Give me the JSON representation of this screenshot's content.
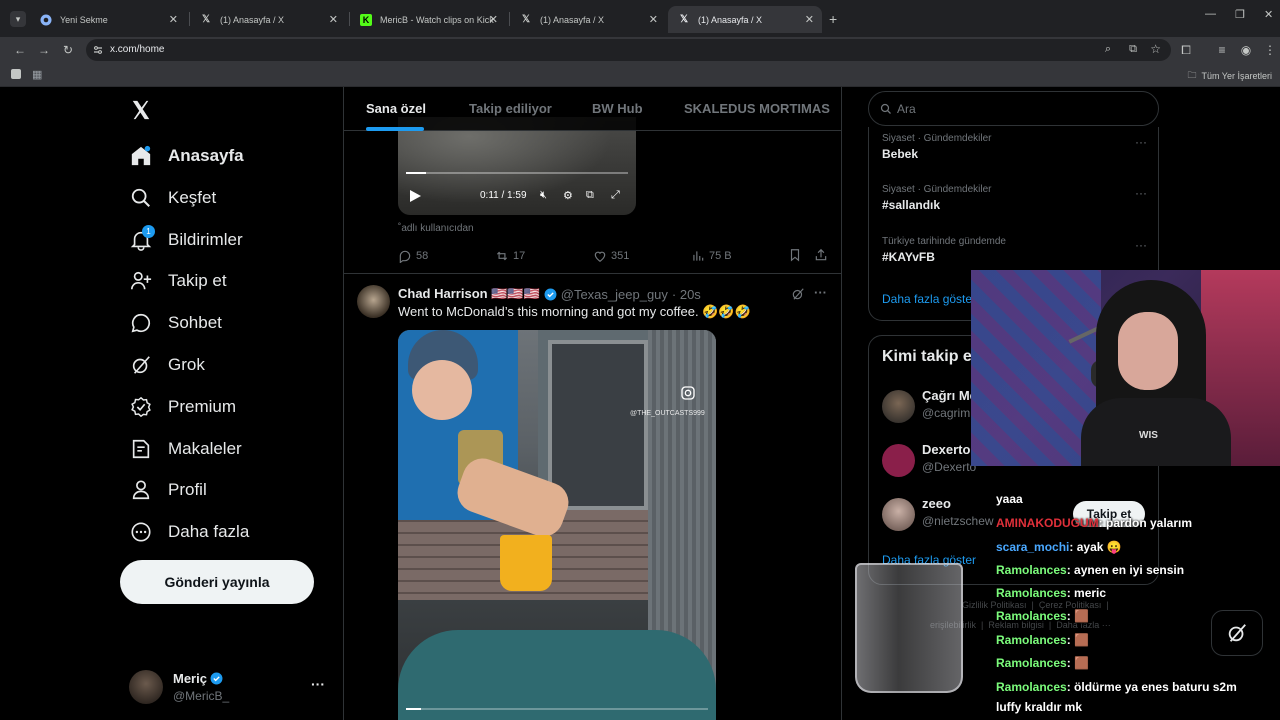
{
  "browser": {
    "tabs": [
      {
        "title": "Yeni Sekme",
        "icon": "chrome-icon"
      },
      {
        "title": "(1) Anasayfa / X",
        "icon": "x-logo-icon"
      },
      {
        "title": "MericB - Watch clips on Kick",
        "icon": "kick-icon"
      },
      {
        "title": "(1) Anasayfa / X",
        "icon": "x-logo-icon"
      },
      {
        "title": "(1) Anasayfa / X",
        "icon": "x-logo-icon",
        "active": true
      }
    ],
    "url": "x.com/home",
    "bookmarks_all": "Tüm Yer İşaretleri"
  },
  "sidebar": {
    "items": [
      {
        "label": "Anasayfa",
        "icon": "home-icon"
      },
      {
        "label": "Keşfet",
        "icon": "search-icon"
      },
      {
        "label": "Bildirimler",
        "icon": "bell-icon",
        "badge": "1"
      },
      {
        "label": "Takip et",
        "icon": "person-add-icon"
      },
      {
        "label": "Sohbet",
        "icon": "chat-icon"
      },
      {
        "label": "Grok",
        "icon": "grok-icon"
      },
      {
        "label": "Premium",
        "icon": "verified-icon"
      },
      {
        "label": "Makaleler",
        "icon": "article-icon"
      },
      {
        "label": "Profil",
        "icon": "person-icon"
      },
      {
        "label": "Daha fazla",
        "icon": "more-circle-icon"
      }
    ],
    "post_button": "Gönderi yayınla",
    "account": {
      "name": "Meriç",
      "handle": "@MericB_"
    }
  },
  "feed": {
    "tabs": [
      "Sana özel",
      "Takip ediliyor",
      "BW Hub",
      "SKALEDUS MORTIMAS"
    ],
    "video1": {
      "time": "0:11 / 1:59",
      "caption": "˚adlı kullanıcıdan",
      "progress": 0.09
    },
    "stats": {
      "replies": "58",
      "reposts": "17",
      "likes": "351",
      "views": "75 B"
    },
    "post2": {
      "author": "Chad Harrison 🇺🇸🇺🇸🇺🇸",
      "handle": "@Texas_jeep_guy",
      "time": "· 20s",
      "text": "Went to McDonald’s this morning and got my coffee. 🤣🤣🤣",
      "watermark": "@THE_OUTCASTS999",
      "progress": 0.05
    }
  },
  "right": {
    "search_placeholder": "Ara",
    "trends": [
      {
        "meta": "Siyaset · Gündemdekiler",
        "name": "Bebek"
      },
      {
        "meta": "Siyaset · Gündemdekiler",
        "name": "#sallandık"
      },
      {
        "meta": "Türkiye tarihinde gündemde",
        "name": "#KAYvFB"
      }
    ],
    "show_more": "Daha fazla göster",
    "who_to_follow_title": "Kimi takip e",
    "follow": [
      {
        "name": "Çağrı Meri",
        "handle": "@cagrim"
      },
      {
        "name": "Dexerto",
        "handle": "@Dexerto"
      },
      {
        "name": "zeeo",
        "handle": "@nietzschew"
      }
    ],
    "follow_button": "Takip et",
    "show_more2": "Daha fazla göster",
    "footer": [
      "Gizlilik Politikası",
      "Çerez Politikası",
      "erişilebilirlik",
      "Reklam bilgisi",
      "Daha fazla ···"
    ]
  },
  "chat": {
    "lines": [
      {
        "user": "",
        "text": "yaaa"
      },
      {
        "user": "AMINAKODUGUM",
        "text": ": pardon yalarım",
        "color": "#e0303a"
      },
      {
        "user": "scara_mochi",
        "text": ": ayak 😛",
        "color": "#4aa8ff"
      },
      {
        "user": "Ramolances",
        "text": ": aynen en iyi sensin",
        "color": "#7cfc7c"
      },
      {
        "user": "Ramolances",
        "text": ": meric",
        "color": "#7cfc7c"
      },
      {
        "user": "Ramolances",
        "text": ": 🟫",
        "color": "#7cfc7c"
      },
      {
        "user": "Ramolances",
        "text": ": 🟫",
        "color": "#7cfc7c"
      },
      {
        "user": "Ramolances",
        "text": ": 🟫",
        "color": "#7cfc7c"
      },
      {
        "user": "Ramolances",
        "text": ": öldürme ya enes baturu s2m",
        "color": "#7cfc7c"
      },
      {
        "user": "",
        "text": "luffy kraldır mk"
      }
    ],
    "webcam_shirt": "WIS"
  },
  "colors": {
    "accent": "#1d9bf0",
    "bg": "#000000",
    "border": "#2f3336",
    "muted": "#71767b"
  }
}
